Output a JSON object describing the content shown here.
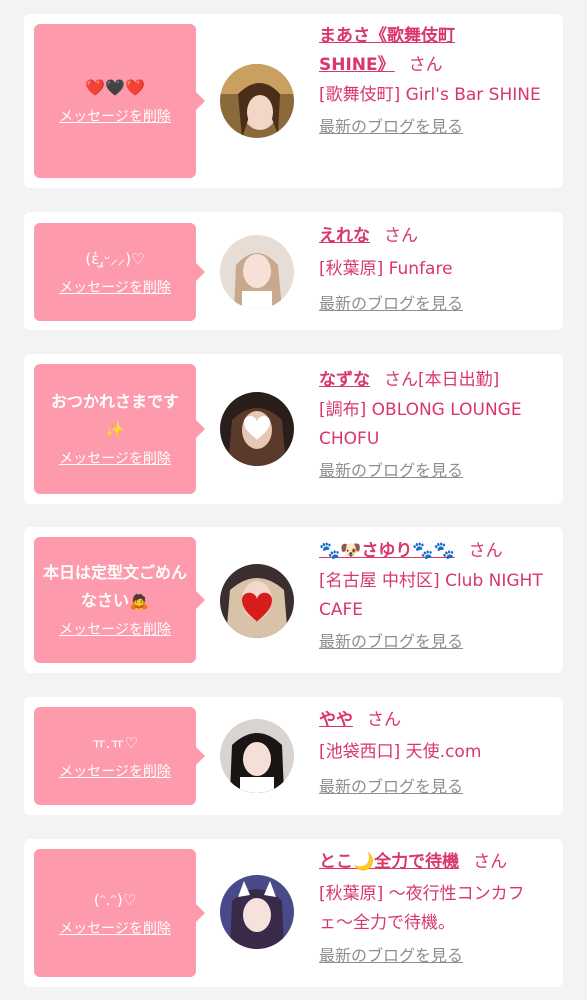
{
  "delete_label": "メッセージを削除",
  "blog_label": "最新のブログを見る",
  "san_label": "さん",
  "colors": {
    "bubble": "#fd9bac",
    "accent": "#d9376a",
    "link_gray": "#8e8e8e",
    "background": "#f3f3f3"
  },
  "items": [
    {
      "message": "❤️🖤❤️",
      "name": "まあさ《歌舞伎町SHINE》",
      "status": "",
      "shop": "[歌舞伎町] Girl's Bar SHINE"
    },
    {
      "message": "(ἑ,̫ᵕ⸝⸝)♡",
      "name": "えれな",
      "status": "",
      "shop": "[秋葉原] Funfare"
    },
    {
      "message": "おつかれさまです✨",
      "name": "なずな",
      "status": "[本日出勤]",
      "shop": "[調布] OBLONG LOUNGE CHOFU"
    },
    {
      "message": "本日は定型文ごめんなさい🙇",
      "name": "🐾🐶さゆり🐾🐾",
      "status": "",
      "shop": "[名古屋 中村区] Club NIGHT CAFE"
    },
    {
      "message": "ㅠ.ㅠ♡",
      "name": "やや",
      "status": "",
      "shop": "[池袋西口] 天使.com"
    },
    {
      "message": "(ᵔ.ᵔ)♡",
      "name": "とこ🌙全力で待機",
      "status": "",
      "shop": "[秋葉原] 〜夜行性コンカフェ〜全力で待機。"
    }
  ]
}
